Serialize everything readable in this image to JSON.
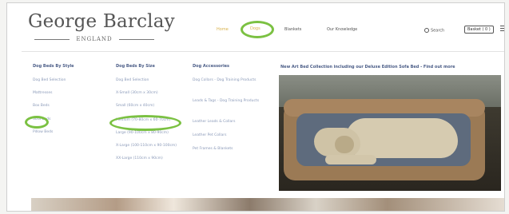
{
  "brand": {
    "title": "George Barclay",
    "subtitle": "ENGLAND"
  },
  "nav": {
    "home": "Home",
    "dogs": "Dogs",
    "blankets": "Blankets",
    "knowledge": "Our Knowledge"
  },
  "header": {
    "search_label": "Search",
    "basket_label": "Basket ( 0 )"
  },
  "menu": {
    "style": {
      "heading": "Dog Beds By Style",
      "items": [
        "Dog Bed Selection",
        "Mattresses",
        "Box Beds",
        "Sofa Beds",
        "Pillow Beds"
      ]
    },
    "size": {
      "heading": "Dog Beds By Size",
      "items": [
        "Dog Bed Selection",
        "X-Small (30cm x 30cm)",
        "Small (60cm x 40cm)",
        "Medium (70-80cm x 60-70cm)",
        "Large (90-100cm x 80-90cm)",
        "X-Large (100-110cm x 90-100cm)",
        "XX-Large (110cm x 90cm)"
      ]
    },
    "accessories": {
      "heading": "Dog Accessories",
      "items": [
        "Dog Collars - Dog Training Products",
        "Leads & Tags - Dog Training Products",
        "Leather Leads & Collars",
        "Leather Pet Collars",
        "Pet Frames & Blankets"
      ]
    }
  },
  "promo": {
    "text": "New Art Bed Collection including our Deluxe Edition Sofa Bed - Find out more"
  },
  "colors": {
    "highlight": "#7bc142",
    "heading": "#4a5c86",
    "accent": "#d8b14a"
  }
}
